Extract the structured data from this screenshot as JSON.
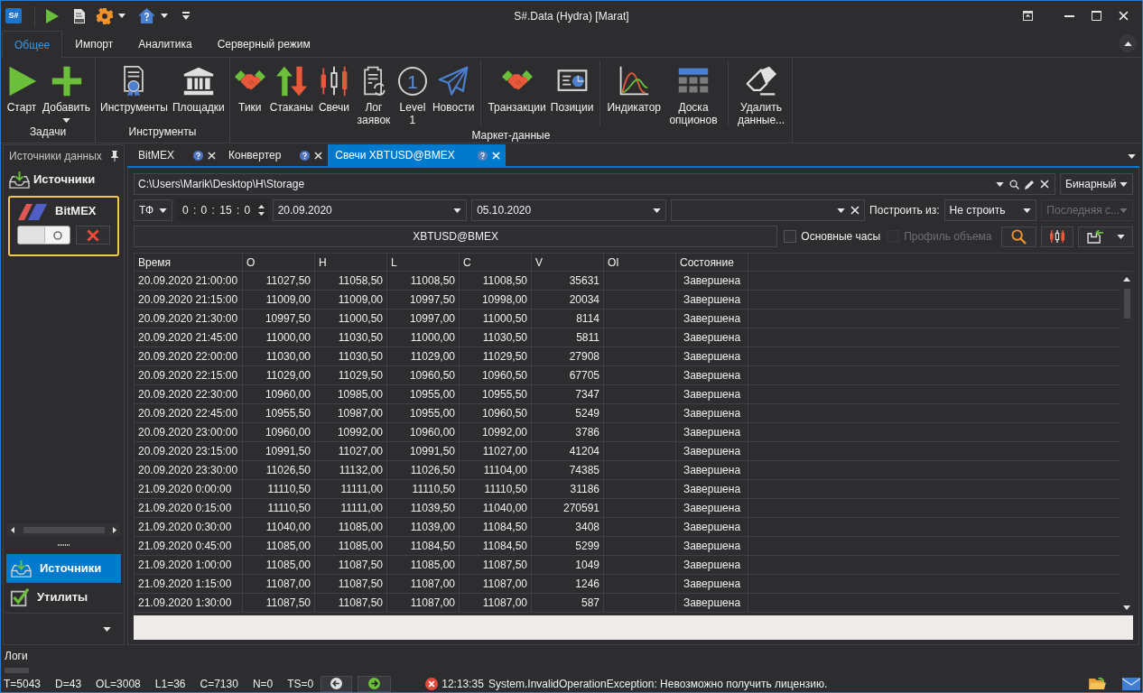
{
  "window": {
    "logo": "S#",
    "title": "S#.Data (Hydra) [Marat]"
  },
  "ribbon": {
    "tabs": [
      {
        "label": "Общее",
        "selected": true
      },
      {
        "label": "Импорт",
        "selected": false
      },
      {
        "label": "Аналитика",
        "selected": false
      },
      {
        "label": "Серверный режим",
        "selected": false
      }
    ],
    "groups": [
      {
        "label": "Задачи",
        "sections": [
          [
            {
              "kind": "start",
              "label": "Старт",
              "dropdown": false
            },
            {
              "kind": "add",
              "label": "Добавить",
              "dropdown": true
            }
          ]
        ]
      },
      {
        "label": "Инструменты",
        "sections": [
          [
            {
              "kind": "securities",
              "label": "Инструменты",
              "dropdown": false
            },
            {
              "kind": "boards",
              "label": "Площадки",
              "dropdown": false
            }
          ]
        ]
      },
      {
        "label": "Маркет-данные",
        "sections": [
          [
            {
              "kind": "ticks",
              "label": "Тики",
              "dropdown": false
            },
            {
              "kind": "depths",
              "label": "Стаканы",
              "dropdown": false
            },
            {
              "kind": "candles",
              "label": "Свечи",
              "dropdown": false
            },
            {
              "kind": "orderlog",
              "label": "Лог заявок",
              "dropdown": false
            },
            {
              "kind": "level1",
              "glyph": "1",
              "label": "Level 1",
              "dropdown": false
            },
            {
              "kind": "news",
              "label": "Новости",
              "dropdown": false
            }
          ],
          [
            {
              "kind": "transactions",
              "label": "Транзакции",
              "dropdown": false
            },
            {
              "kind": "positions",
              "label": "Позиции",
              "dropdown": false
            }
          ],
          [
            {
              "kind": "indicator",
              "label": "Индикатор",
              "dropdown": false
            },
            {
              "kind": "options",
              "label": "Доска опционов",
              "dropdown": false
            }
          ],
          [
            {
              "kind": "erase",
              "label": "Удалить данные...",
              "dropdown": false
            }
          ]
        ]
      }
    ]
  },
  "sources_panel": {
    "title": "Источники данных",
    "heading": "Источники",
    "sources": [
      {
        "name": "BitMEX",
        "selected": true,
        "enabled": false
      }
    ],
    "nav": [
      {
        "kind": "sources",
        "label": "Источники",
        "selected": true
      },
      {
        "kind": "utilities",
        "label": "Утилиты",
        "selected": false
      }
    ]
  },
  "document_tabs": [
    {
      "label": "BitMEX",
      "selected": false
    },
    {
      "label": "Конвертер",
      "selected": false
    },
    {
      "label": "Свечи XBTUSD@BMEX",
      "selected": true
    }
  ],
  "candles_view": {
    "storage_path": "C:\\Users\\Marik\\Desktop\\H\\Storage",
    "format": "Бинарный",
    "timeframe_label": "ТФ",
    "timeframe": "0 : 0 : 15 : 0",
    "date_from": "20.09.2020",
    "date_to": "05.10.2020",
    "build_from_label": "Построить из:",
    "build_from": "Не строить",
    "build_source": {
      "value": "Последняя с...",
      "disabled": true
    },
    "security": "XBTUSD@BMEX",
    "options": [
      {
        "label": "Основные часы",
        "checked": false,
        "disabled": false
      },
      {
        "label": "Профиль объема",
        "checked": false,
        "disabled": true
      }
    ],
    "table": {
      "columns": [
        "Время",
        "O",
        "H",
        "L",
        "C",
        "V",
        "OI",
        "Состояние"
      ],
      "rows": [
        {
          "time": "20.09.2020 21:00:00",
          "open": "11027,50",
          "high": "11058,50",
          "low": "11008,50",
          "close": "11008,50",
          "volume": "35631",
          "state": "Завершена"
        },
        {
          "time": "20.09.2020 21:15:00",
          "open": "11009,00",
          "high": "11009,00",
          "low": "10997,50",
          "close": "10998,00",
          "volume": "20034",
          "state": "Завершена"
        },
        {
          "time": "20.09.2020 21:30:00",
          "open": "10997,50",
          "high": "11000,50",
          "low": "10997,00",
          "close": "11000,50",
          "volume": "8114",
          "state": "Завершена"
        },
        {
          "time": "20.09.2020 21:45:00",
          "open": "11000,00",
          "high": "11030,50",
          "low": "11000,00",
          "close": "11030,50",
          "volume": "5811",
          "state": "Завершена"
        },
        {
          "time": "20.09.2020 22:00:00",
          "open": "11030,00",
          "high": "11030,50",
          "low": "11029,00",
          "close": "11029,50",
          "volume": "27908",
          "state": "Завершена"
        },
        {
          "time": "20.09.2020 22:15:00",
          "open": "11029,00",
          "high": "11029,50",
          "low": "10960,50",
          "close": "10960,50",
          "volume": "67705",
          "state": "Завершена"
        },
        {
          "time": "20.09.2020 22:30:00",
          "open": "10960,00",
          "high": "10985,00",
          "low": "10955,00",
          "close": "10955,50",
          "volume": "7347",
          "state": "Завершена"
        },
        {
          "time": "20.09.2020 22:45:00",
          "open": "10955,50",
          "high": "10987,00",
          "low": "10955,00",
          "close": "10960,50",
          "volume": "5249",
          "state": "Завершена"
        },
        {
          "time": "20.09.2020 23:00:00",
          "open": "10960,00",
          "high": "10992,00",
          "low": "10960,00",
          "close": "10992,00",
          "volume": "3786",
          "state": "Завершена"
        },
        {
          "time": "20.09.2020 23:15:00",
          "open": "10991,50",
          "high": "11027,00",
          "low": "10991,50",
          "close": "11027,00",
          "volume": "41204",
          "state": "Завершена"
        },
        {
          "time": "20.09.2020 23:30:00",
          "open": "11026,50",
          "high": "11132,00",
          "low": "11026,50",
          "close": "11104,00",
          "volume": "74385",
          "state": "Завершена"
        },
        {
          "time": "21.09.2020 0:00:00",
          "open": "11110,50",
          "high": "11111,00",
          "low": "11110,50",
          "close": "11110,50",
          "volume": "31186",
          "state": "Завершена"
        },
        {
          "time": "21.09.2020 0:15:00",
          "open": "11110,50",
          "high": "11111,00",
          "low": "11039,50",
          "close": "11040,00",
          "volume": "270591",
          "state": "Завершена"
        },
        {
          "time": "21.09.2020 0:30:00",
          "open": "11040,00",
          "high": "11085,00",
          "low": "11039,00",
          "close": "11084,50",
          "volume": "3408",
          "state": "Завершена"
        },
        {
          "time": "21.09.2020 0:45:00",
          "open": "11085,00",
          "high": "11085,00",
          "low": "11084,50",
          "close": "11084,50",
          "volume": "5299",
          "state": "Завершена"
        },
        {
          "time": "21.09.2020 1:00:00",
          "open": "11085,00",
          "high": "11087,50",
          "low": "11085,00",
          "close": "11087,50",
          "volume": "1049",
          "state": "Завершена"
        },
        {
          "time": "21.09.2020 1:15:00",
          "open": "11087,00",
          "high": "11087,50",
          "low": "11087,00",
          "close": "11087,00",
          "volume": "1246",
          "state": "Завершена"
        },
        {
          "time": "21.09.2020 1:30:00",
          "open": "11087,50",
          "high": "11087,50",
          "low": "11087,00",
          "close": "11087,00",
          "volume": "587",
          "state": "Завершена"
        }
      ]
    }
  },
  "logs_panel": {
    "title": "Логи"
  },
  "status_bar": {
    "counters": [
      "T=5043",
      "D=43",
      "OL=3008",
      "L1=36",
      "C=7130",
      "N=0",
      "TS=0"
    ],
    "message": {
      "kind": "error",
      "time": "12:13:35",
      "text": "System.InvalidOperationException: Невозможно получить лицензию."
    }
  }
}
